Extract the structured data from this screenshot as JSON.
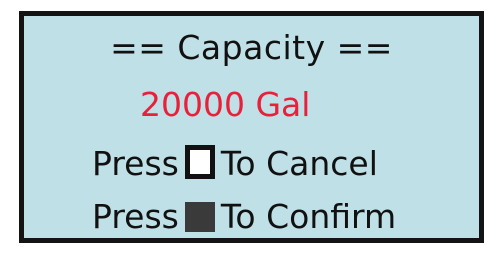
{
  "screen": {
    "title": "== Capacity ==",
    "value": "20000 Gal",
    "cancel": {
      "press_label": "Press",
      "action_label": "To Cancel"
    },
    "confirm": {
      "press_label": "Press",
      "action_label": "To Confirm"
    },
    "colors": {
      "background": "#bfe0e6",
      "value_text": "#e8203a",
      "text": "#111111",
      "border": "#141414"
    },
    "icons": {
      "cancel_key": "white-square-key-icon",
      "confirm_key": "dark-square-key-icon"
    }
  }
}
